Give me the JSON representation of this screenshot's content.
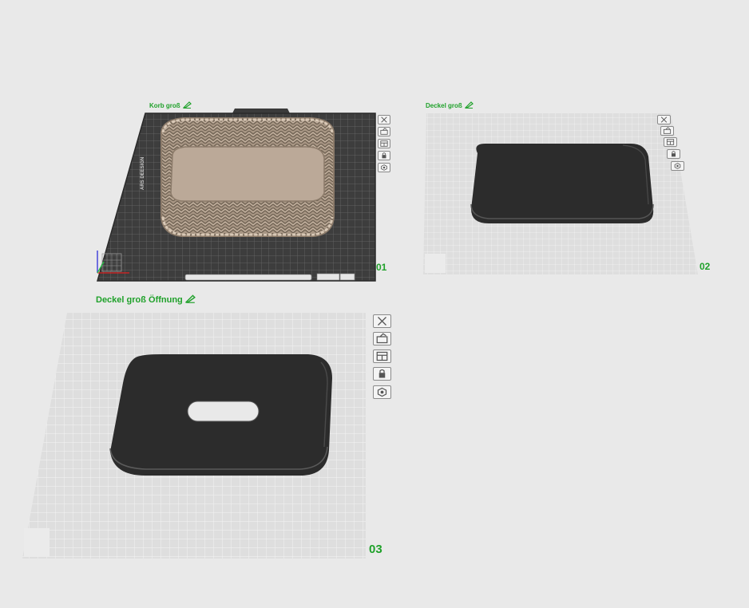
{
  "plates": [
    {
      "name": "Korb groß",
      "number": "01",
      "object": "basket",
      "bed_style": "dark"
    },
    {
      "name": "Deckel groß",
      "number": "02",
      "object": "lid",
      "bed_style": "light"
    },
    {
      "name": "Deckel groß Öffnung",
      "number": "03",
      "object": "lid-with-opening",
      "bed_style": "light"
    }
  ],
  "plate_tools": [
    "close-icon",
    "arrange-icon",
    "layout-icon",
    "lock-icon",
    "settings-icon"
  ],
  "colors": {
    "background": "#e9e9e9",
    "plate_label": "#1fa12a",
    "dark_bed": "#3d3d3d",
    "light_bed": "#dcdcdc",
    "lid": "#2c2c2c",
    "basket": "#bba998"
  }
}
